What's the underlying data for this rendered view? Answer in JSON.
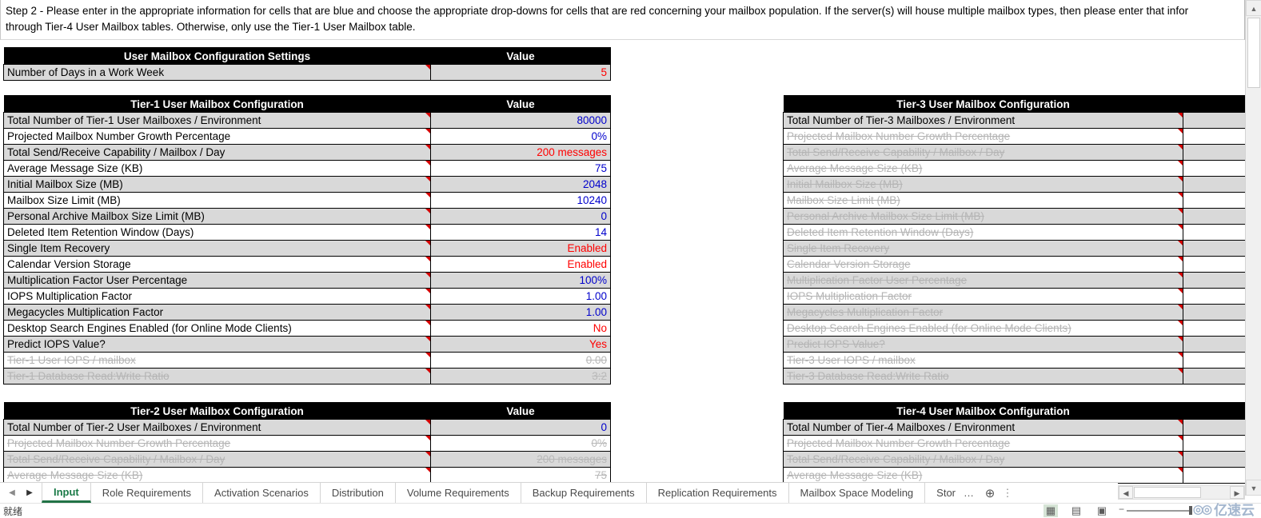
{
  "instruction": {
    "line1": "Step 2 - Please enter in the appropriate information for cells that are blue and choose the appropriate drop-downs for cells that are red concerning your mailbox population.  If the server(s) will house multiple mailbox types, then please enter that infor",
    "line2": "through Tier-4 User Mailbox tables.  Otherwise, only use the Tier-1 User Mailbox table."
  },
  "colors": {
    "header_bg": "#000000",
    "header_fg": "#ffffff",
    "shade_row": "#d9d9d9",
    "value_blue": "#0000cc",
    "value_red": "#ff0000",
    "disabled_gray": "#b5b5b5",
    "comment_marker": "#d40000",
    "active_tab": "#217346"
  },
  "settings_table": {
    "col_label": "User Mailbox Configuration Settings",
    "col_value": "Value",
    "rows": [
      {
        "label": "Number of Days in a Work Week",
        "value": "5",
        "value_color": "red",
        "shade": true,
        "disabled": false,
        "comment": true
      }
    ]
  },
  "tier1": {
    "col_label": "Tier-1 User Mailbox Configuration",
    "col_value": "Value",
    "rows": [
      {
        "label": "Total Number of Tier-1 User Mailboxes / Environment",
        "value": "80000",
        "value_color": "blue",
        "shade": true,
        "disabled": false,
        "comment": true
      },
      {
        "label": "Projected Mailbox Number Growth Percentage",
        "value": "0%",
        "value_color": "blue",
        "shade": false,
        "disabled": false,
        "comment": true
      },
      {
        "label": "Total Send/Receive Capability / Mailbox / Day",
        "value": "200 messages",
        "value_color": "red",
        "shade": true,
        "disabled": false,
        "comment": true
      },
      {
        "label": "Average Message Size (KB)",
        "value": "75",
        "value_color": "blue",
        "shade": false,
        "disabled": false,
        "comment": true
      },
      {
        "label": "Initial Mailbox Size (MB)",
        "value": "2048",
        "value_color": "blue",
        "shade": true,
        "disabled": false,
        "comment": true
      },
      {
        "label": "Mailbox Size Limit (MB)",
        "value": "10240",
        "value_color": "blue",
        "shade": false,
        "disabled": false,
        "comment": true
      },
      {
        "label": "Personal Archive Mailbox Size Limit (MB)",
        "value": "0",
        "value_color": "blue",
        "shade": true,
        "disabled": false,
        "comment": true
      },
      {
        "label": "Deleted Item Retention Window (Days)",
        "value": "14",
        "value_color": "blue",
        "shade": false,
        "disabled": false,
        "comment": true
      },
      {
        "label": "Single Item Recovery",
        "value": "Enabled",
        "value_color": "red",
        "shade": true,
        "disabled": false,
        "comment": true
      },
      {
        "label": "Calendar Version Storage",
        "value": "Enabled",
        "value_color": "red",
        "shade": false,
        "disabled": false,
        "comment": true
      },
      {
        "label": "Multiplication Factor User Percentage",
        "value": "100%",
        "value_color": "blue",
        "shade": true,
        "disabled": false,
        "comment": true
      },
      {
        "label": "IOPS Multiplication Factor",
        "value": "1.00",
        "value_color": "blue",
        "shade": false,
        "disabled": false,
        "comment": true
      },
      {
        "label": "Megacycles Multiplication Factor",
        "value": "1.00",
        "value_color": "blue",
        "shade": true,
        "disabled": false,
        "comment": true
      },
      {
        "label": "Desktop Search Engines Enabled (for Online Mode Clients)",
        "value": "No",
        "value_color": "red",
        "shade": false,
        "disabled": false,
        "comment": true
      },
      {
        "label": "Predict IOPS Value?",
        "value": "Yes",
        "value_color": "red",
        "shade": true,
        "disabled": false,
        "comment": true
      },
      {
        "label": "Tier-1 User IOPS / mailbox",
        "value": "0.00",
        "value_color": "blue",
        "shade": false,
        "disabled": true,
        "comment": true
      },
      {
        "label": "Tier-1 Database Read:Write Ratio",
        "value": "3:2",
        "value_color": "blue",
        "shade": true,
        "disabled": true,
        "comment": true
      }
    ]
  },
  "tier2": {
    "col_label": "Tier-2 User Mailbox Configuration",
    "col_value": "Value",
    "rows": [
      {
        "label": "Total Number of Tier-2 User Mailboxes / Environment",
        "value": "0",
        "value_color": "blue",
        "shade": true,
        "disabled": false,
        "comment": true
      },
      {
        "label": "Projected Mailbox Number Growth Percentage",
        "value": "0%",
        "value_color": "blue",
        "shade": false,
        "disabled": true,
        "comment": true
      },
      {
        "label": "Total Send/Receive Capability / Mailbox / Day",
        "value": "200 messages",
        "value_color": "red",
        "shade": true,
        "disabled": true,
        "comment": true
      },
      {
        "label": "Average Message Size (KB)",
        "value": "75",
        "value_color": "blue",
        "shade": false,
        "disabled": true,
        "comment": true
      }
    ]
  },
  "tier3": {
    "col_label": "Tier-3 User Mailbox Configuration",
    "col_value": "",
    "rows": [
      {
        "label": "Total Number of Tier-3 Mailboxes / Environment",
        "value": "",
        "value_color": "blue",
        "shade": true,
        "disabled": false,
        "comment": true
      },
      {
        "label": "Projected Mailbox Number Growth Percentage",
        "value": "",
        "value_color": "blue",
        "shade": false,
        "disabled": true,
        "comment": true
      },
      {
        "label": "Total Send/Receive Capability / Mailbox / Day",
        "value": "",
        "value_color": "red",
        "shade": true,
        "disabled": true,
        "comment": true
      },
      {
        "label": "Average Message Size (KB)",
        "value": "",
        "value_color": "blue",
        "shade": false,
        "disabled": true,
        "comment": true
      },
      {
        "label": "Initial Mailbox Size (MB)",
        "value": "",
        "value_color": "blue",
        "shade": true,
        "disabled": true,
        "comment": true
      },
      {
        "label": "Mailbox Size Limit (MB)",
        "value": "",
        "value_color": "blue",
        "shade": false,
        "disabled": true,
        "comment": true
      },
      {
        "label": "Personal Archive Mailbox Size Limit (MB)",
        "value": "",
        "value_color": "blue",
        "shade": true,
        "disabled": true,
        "comment": true
      },
      {
        "label": "Deleted Item Retention Window (Days)",
        "value": "",
        "value_color": "blue",
        "shade": false,
        "disabled": true,
        "comment": true
      },
      {
        "label": "Single Item Recovery",
        "value": "",
        "value_color": "red",
        "shade": true,
        "disabled": true,
        "comment": true
      },
      {
        "label": "Calendar Version Storage",
        "value": "",
        "value_color": "red",
        "shade": false,
        "disabled": true,
        "comment": true
      },
      {
        "label": "Multiplication Factor User Percentage",
        "value": "",
        "value_color": "blue",
        "shade": true,
        "disabled": true,
        "comment": true
      },
      {
        "label": "IOPS Multiplication Factor",
        "value": "",
        "value_color": "blue",
        "shade": false,
        "disabled": true,
        "comment": true
      },
      {
        "label": "Megacycles Multiplication Factor",
        "value": "",
        "value_color": "blue",
        "shade": true,
        "disabled": true,
        "comment": true
      },
      {
        "label": "Desktop Search Engines Enabled (for Online Mode Clients)",
        "value": "",
        "value_color": "red",
        "shade": false,
        "disabled": true,
        "comment": true
      },
      {
        "label": "Predict IOPS Value?",
        "value": "",
        "value_color": "red",
        "shade": true,
        "disabled": true,
        "comment": true
      },
      {
        "label": "Tier-3 User IOPS / mailbox",
        "value": "",
        "value_color": "blue",
        "shade": false,
        "disabled": true,
        "comment": true
      },
      {
        "label": "Tier-3 Database Read:Write Ratio",
        "value": "",
        "value_color": "blue",
        "shade": true,
        "disabled": true,
        "comment": true
      }
    ]
  },
  "tier4": {
    "col_label": "Tier-4 User Mailbox Configuration",
    "col_value": "",
    "rows": [
      {
        "label": "Total Number of Tier-4 Mailboxes / Environment",
        "value": "",
        "value_color": "blue",
        "shade": true,
        "disabled": false,
        "comment": true
      },
      {
        "label": "Projected Mailbox Number Growth Percentage",
        "value": "",
        "value_color": "blue",
        "shade": false,
        "disabled": true,
        "comment": true
      },
      {
        "label": "Total Send/Receive Capability / Mailbox / Day",
        "value": "",
        "value_color": "red",
        "shade": true,
        "disabled": true,
        "comment": true
      },
      {
        "label": "Average Message Size (KB)",
        "value": "",
        "value_color": "blue",
        "shade": false,
        "disabled": true,
        "comment": true
      }
    ]
  },
  "tabbar": {
    "prev_label": "◀",
    "next_label": "▶",
    "tabs": [
      {
        "label": "Input",
        "active": true
      },
      {
        "label": "Role Requirements",
        "active": false
      },
      {
        "label": "Activation Scenarios",
        "active": false
      },
      {
        "label": "Distribution",
        "active": false
      },
      {
        "label": "Volume Requirements",
        "active": false
      },
      {
        "label": "Backup Requirements",
        "active": false
      },
      {
        "label": "Replication Requirements",
        "active": false
      },
      {
        "label": "Mailbox Space Modeling",
        "active": false
      },
      {
        "label": "Stor",
        "active": false,
        "truncated": true
      }
    ],
    "more_label": "…",
    "add_label": "⊕",
    "options_label": "⋮"
  },
  "statusbar": {
    "ready_text": "就绪",
    "view_normal": "▦",
    "view_page_layout": "▤",
    "view_page_break": "▣",
    "zoom_minus": "−"
  },
  "watermark": {
    "logo": "◎◎",
    "text": "亿速云"
  }
}
